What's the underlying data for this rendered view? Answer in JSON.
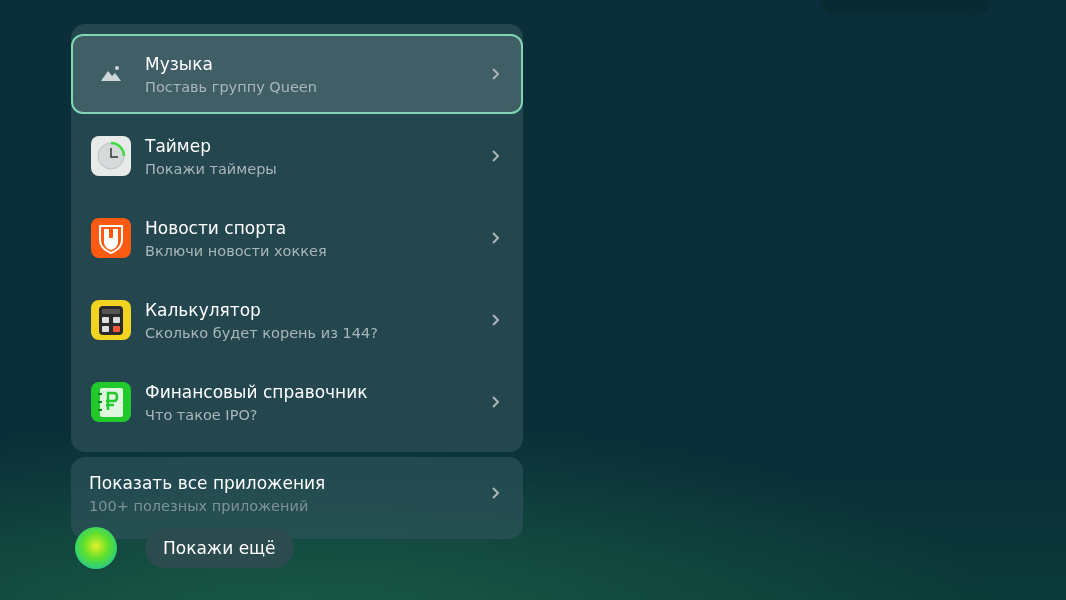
{
  "apps": [
    {
      "title": "Музыка",
      "subtitle": "Поставь группу Queen",
      "selected": true
    },
    {
      "title": "Таймер",
      "subtitle": "Покажи таймеры",
      "selected": false
    },
    {
      "title": "Новости спорта",
      "subtitle": "Включи новости хоккея",
      "selected": false
    },
    {
      "title": "Калькулятор",
      "subtitle": "Сколько будет корень из 144?",
      "selected": false
    },
    {
      "title": "Финансовый справочник",
      "subtitle": "Что такое IPO?",
      "selected": false
    }
  ],
  "all_apps": {
    "title": "Показать все приложения",
    "subtitle": "100+ полезных приложений"
  },
  "suggestion": "Покажи ещё"
}
